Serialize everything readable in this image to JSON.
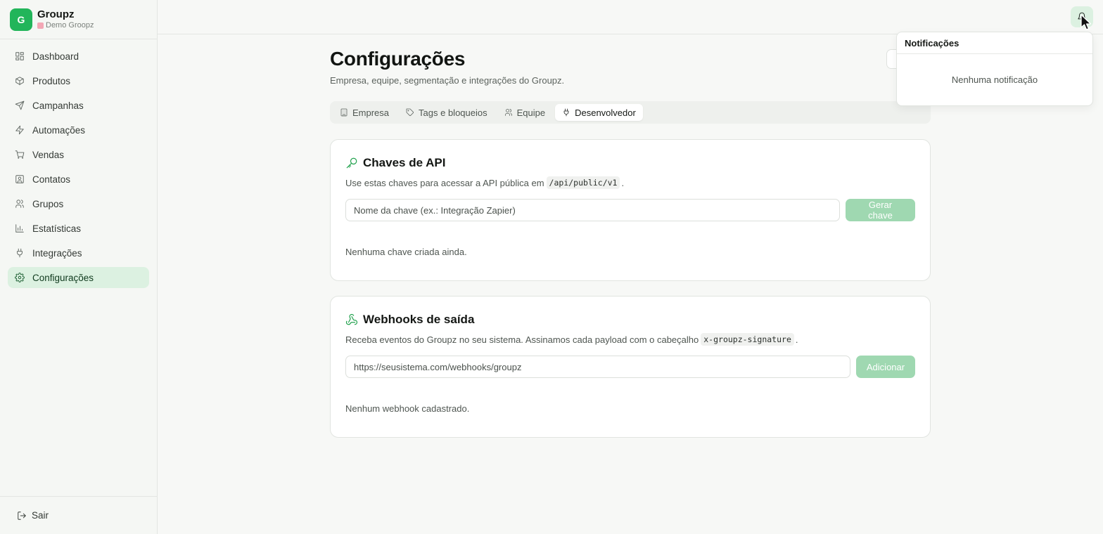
{
  "brand": {
    "logo_letter": "G",
    "name": "Groupz",
    "workspace": "Demo Groopz"
  },
  "sidebar": {
    "items": [
      {
        "label": "Dashboard",
        "icon": "dashboard-icon"
      },
      {
        "label": "Produtos",
        "icon": "package-icon"
      },
      {
        "label": "Campanhas",
        "icon": "send-icon"
      },
      {
        "label": "Automações",
        "icon": "zap-icon"
      },
      {
        "label": "Vendas",
        "icon": "cart-icon"
      },
      {
        "label": "Contatos",
        "icon": "contact-icon"
      },
      {
        "label": "Grupos",
        "icon": "users-icon"
      },
      {
        "label": "Estatísticas",
        "icon": "bar-chart-icon"
      },
      {
        "label": "Integrações",
        "icon": "plug-icon"
      },
      {
        "label": "Configurações",
        "icon": "gear-icon",
        "active": true
      }
    ],
    "logout_label": "Sair"
  },
  "page": {
    "title": "Configurações",
    "subtitle": "Empresa, equipe, segmentação e integrações do Groupz."
  },
  "tabs": [
    {
      "label": "Empresa",
      "icon": "building-icon"
    },
    {
      "label": "Tags e bloqueios",
      "icon": "tag-icon"
    },
    {
      "label": "Equipe",
      "icon": "users-icon"
    },
    {
      "label": "Desenvolvedor",
      "icon": "plug-icon",
      "active": true
    }
  ],
  "api_keys": {
    "title": "Chaves de API",
    "desc_before": "Use estas chaves para acessar a API pública em",
    "desc_code": "/api/public/v1",
    "desc_after": ".",
    "input_placeholder": "Nome da chave (ex.: Integração Zapier)",
    "button_label": "Gerar chave",
    "empty_text": "Nenhuma chave criada ainda."
  },
  "webhooks": {
    "title": "Webhooks de saída",
    "desc_before": "Receba eventos do Groupz no seu sistema. Assinamos cada payload com o cabeçalho",
    "desc_code": "x-groupz-signature",
    "desc_after": ".",
    "input_placeholder": "https://seusistema.com/webhooks/groupz",
    "button_label": "Adicionar",
    "empty_text": "Nenhum webhook cadastrado."
  },
  "notifications": {
    "title": "Notificações",
    "empty_text": "Nenhuma notificação"
  },
  "colors": {
    "accent": "#22b55a",
    "active_bg": "#dcf1e1",
    "button_disabled": "#9fd8b1"
  }
}
